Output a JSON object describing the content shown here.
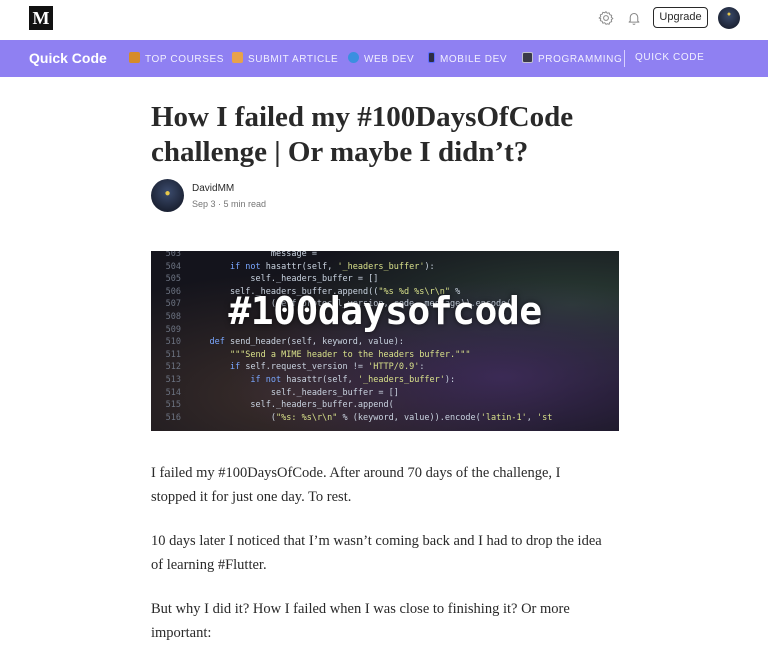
{
  "topbar": {
    "logo": "M",
    "icons": [
      "gear-icon",
      "bell-icon"
    ],
    "upgrade_label": "Upgrade"
  },
  "publication": {
    "name": "Quick Code",
    "nav": [
      {
        "label": "TOP COURSES",
        "icon": "book-emoji",
        "color": "#e0a030"
      },
      {
        "label": "SUBMIT ARTICLE",
        "icon": "pencil-emoji",
        "color": "#e8a24a"
      },
      {
        "label": "WEB DEV",
        "icon": "globe-emoji",
        "color": "#3a8fe0"
      },
      {
        "label": "MOBILE DEV",
        "icon": "phone-emoji",
        "color": "#5c6cff"
      },
      {
        "label": "PROGRAMMING",
        "icon": "laptop-emoji",
        "color": "#4a4a5a"
      },
      {
        "label": "QUICK CODE",
        "icon": "",
        "color": ""
      }
    ],
    "accent_color": "#8f80f2"
  },
  "article": {
    "title": "How I failed my #100DaysOfCode challenge | Or maybe I didn’t?",
    "author": "DavidMM",
    "meta": "Sep 3 · 5 min read",
    "hero_text": "#100daysofcode",
    "paragraphs": [
      "I failed my #100DaysOfCode. After around 70 days of the challenge, I stopped it for just one day. To rest.",
      "10 days later I noticed that I’m wasn’t coming back and I had to drop the idea of learning #Flutter.",
      "But why I did it? How I failed when I was close to finishing it? Or more important:"
    ]
  }
}
